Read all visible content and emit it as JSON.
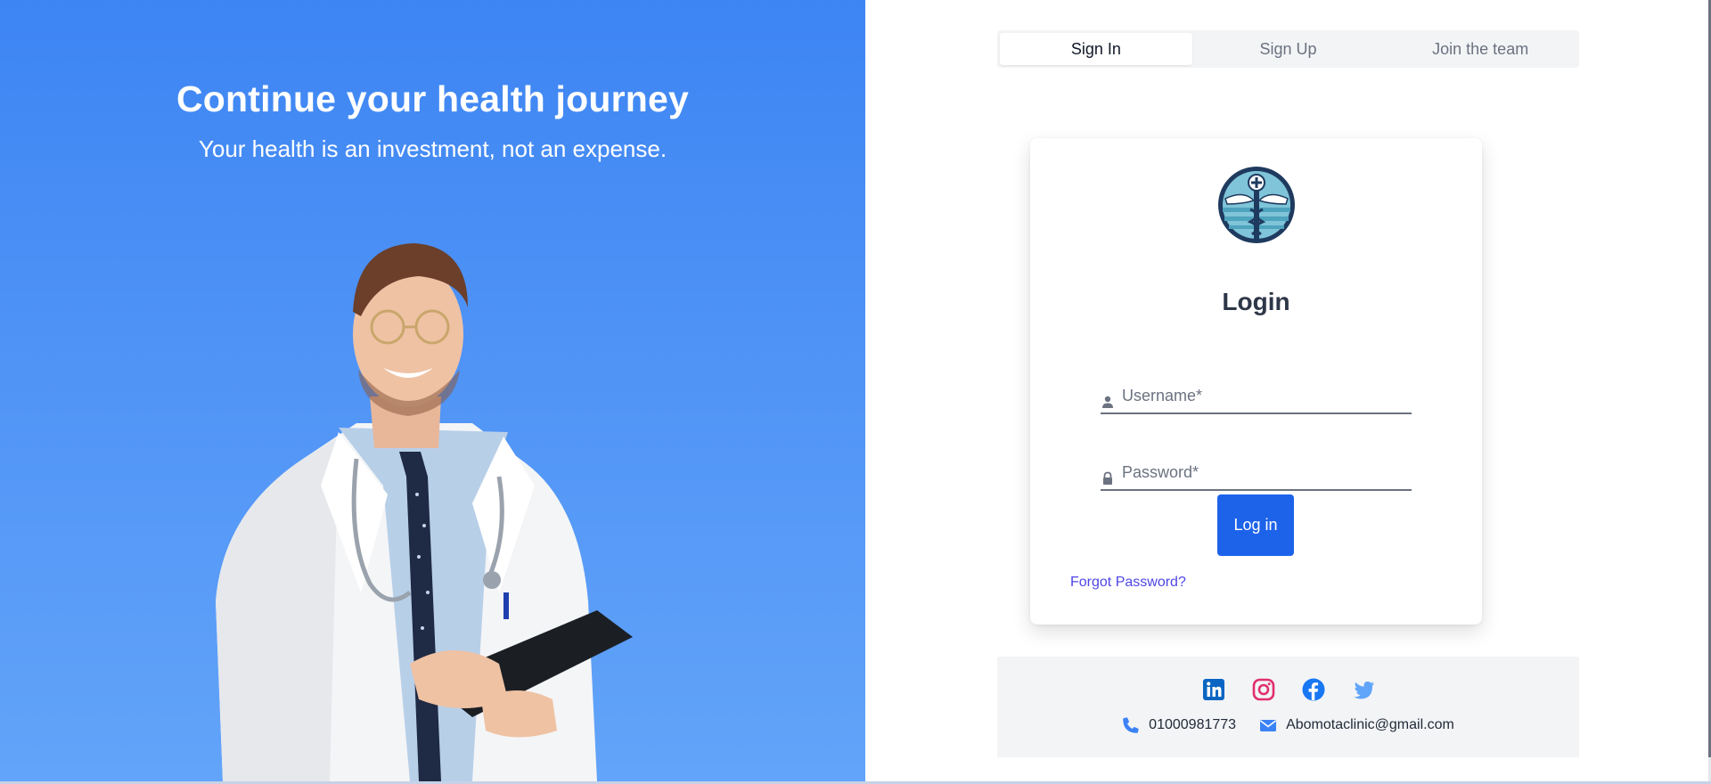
{
  "hero": {
    "title": "Continue your health journey",
    "subtitle": "Your health is an investment, not an expense.",
    "image": "doctor-holding-tablet",
    "gradient": [
      "#3d85f3",
      "#62a4f9"
    ]
  },
  "tabs": [
    {
      "label": "Sign In",
      "active": true
    },
    {
      "label": "Sign Up",
      "active": false
    },
    {
      "label": "Join the team",
      "active": false
    }
  ],
  "login": {
    "logo": "caduceus-logo",
    "title": "Login",
    "username_placeholder": "Username*",
    "username_icon": "user-icon",
    "password_placeholder": "Password*",
    "password_icon": "lock-icon",
    "submit_label": "Log in",
    "forgot_label": "Forgot Password?"
  },
  "footer": {
    "socials": [
      {
        "name": "linkedin-icon",
        "color": "#0a66c2"
      },
      {
        "name": "instagram-icon",
        "color": "#e1306c"
      },
      {
        "name": "facebook-icon",
        "color": "#1877f2"
      },
      {
        "name": "twitter-icon",
        "color": "#60a5fa"
      }
    ],
    "phone": "01000981773",
    "email": "Abomotaclinic@gmail.com"
  },
  "colors": {
    "accent": "#1d63ea",
    "link": "#4f46e5"
  }
}
